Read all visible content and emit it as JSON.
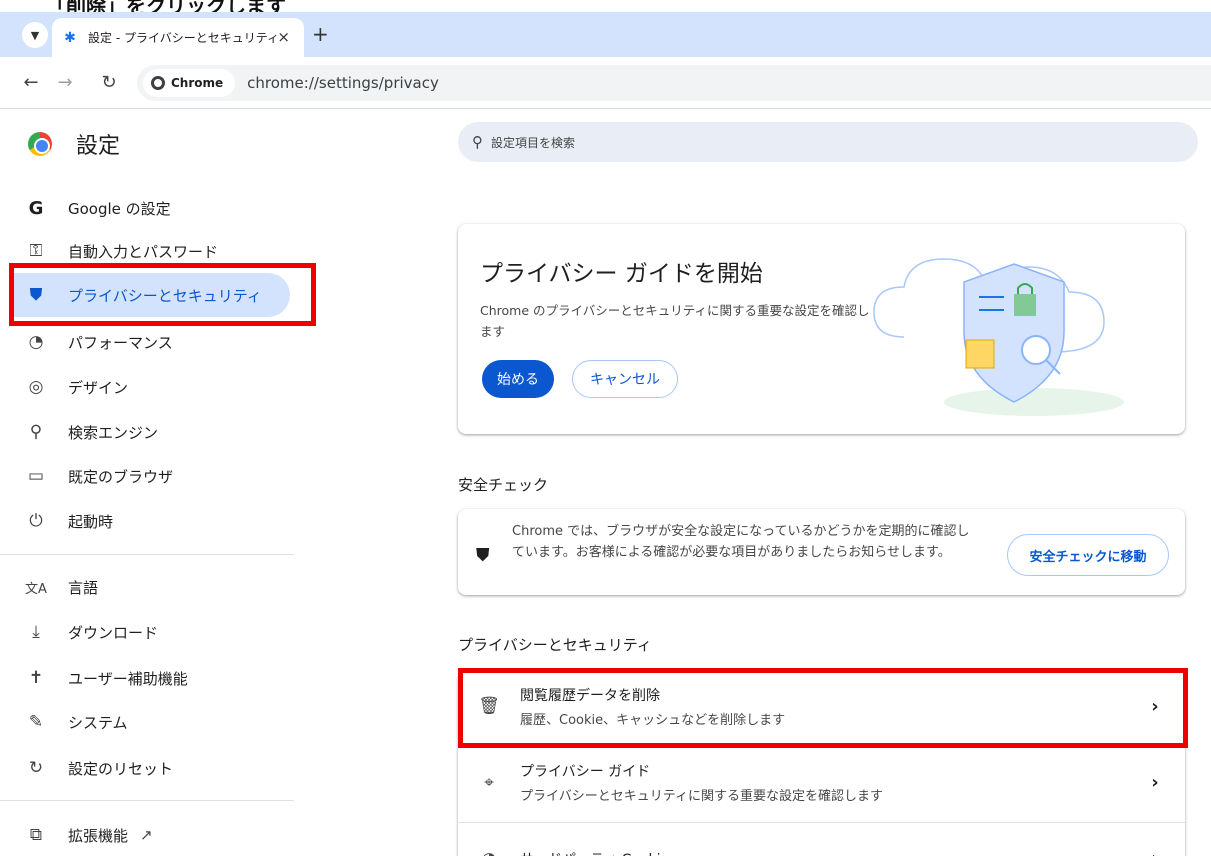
{
  "top_caption": "「削除」をクリックします",
  "browser": {
    "tab_title": "設定 - プライバシーとセキュリティ",
    "close_glyph": "×",
    "new_tab_glyph": "+",
    "chip_label": "Chrome",
    "url": "chrome://settings/privacy"
  },
  "sidebar": {
    "title": "設定",
    "items": [
      {
        "label": "Google の設定",
        "icon": "google-g-icon",
        "glyph": "G"
      },
      {
        "label": "自動入力とパスワード",
        "icon": "key-icon",
        "glyph": "⚿"
      },
      {
        "label": "プライバシーとセキュリティ",
        "icon": "shield-icon",
        "glyph": "⛊"
      },
      {
        "label": "パフォーマンス",
        "icon": "speedometer-icon",
        "glyph": "◔"
      },
      {
        "label": "デザイン",
        "icon": "palette-icon",
        "glyph": "◎"
      },
      {
        "label": "検索エンジン",
        "icon": "search-icon",
        "glyph": "⚲"
      },
      {
        "label": "既定のブラウザ",
        "icon": "browser-window-icon",
        "glyph": "▭"
      },
      {
        "label": "起動時",
        "icon": "power-icon",
        "glyph": "⏻"
      },
      {
        "label": "言語",
        "icon": "translate-icon",
        "glyph": "文A"
      },
      {
        "label": "ダウンロード",
        "icon": "download-icon",
        "glyph": "⤓"
      },
      {
        "label": "ユーザー補助機能",
        "icon": "accessibility-icon",
        "glyph": "✝"
      },
      {
        "label": "システム",
        "icon": "wrench-icon",
        "glyph": "✎"
      },
      {
        "label": "設定のリセット",
        "icon": "reset-icon",
        "glyph": "↻"
      },
      {
        "label": "拡張機能",
        "icon": "puzzle-icon",
        "glyph": "⧉"
      }
    ],
    "active_index": 2
  },
  "search": {
    "placeholder": "設定項目を検索"
  },
  "privacy_guide_card": {
    "title": "プライバシー ガイドを開始",
    "description": "Chrome のプライバシーとセキュリティに関する重要な設定を確認します",
    "start_label": "始める",
    "cancel_label": "キャンセル"
  },
  "safety_check": {
    "heading": "安全チェック",
    "text": "Chrome では、ブラウザが安全な設定になっているかどうかを定期的に確認しています。お客様による確認が必要な項目がありましたらお知らせします。",
    "button_label": "安全チェックに移動"
  },
  "privacy_section": {
    "heading": "プライバシーとセキュリティ",
    "rows": [
      {
        "title": "閲覧履歴データを削除",
        "desc": "履歴、Cookie、キャッシュなどを削除します",
        "icon": "trash-icon",
        "glyph": "🗑"
      },
      {
        "title": "プライバシー ガイド",
        "desc": "プライバシーとセキュリティに関する重要な設定を確認します",
        "icon": "privacy-guide-icon",
        "glyph": "⌖"
      },
      {
        "title": "サードパーティ Cookie",
        "desc": "",
        "icon": "cookie-icon",
        "glyph": "◕"
      }
    ],
    "arrow_glyph": "›"
  },
  "colors": {
    "accent": "#0b57d0",
    "highlight_box": "#ee0000",
    "tabstrip": "#d3e3fd"
  }
}
